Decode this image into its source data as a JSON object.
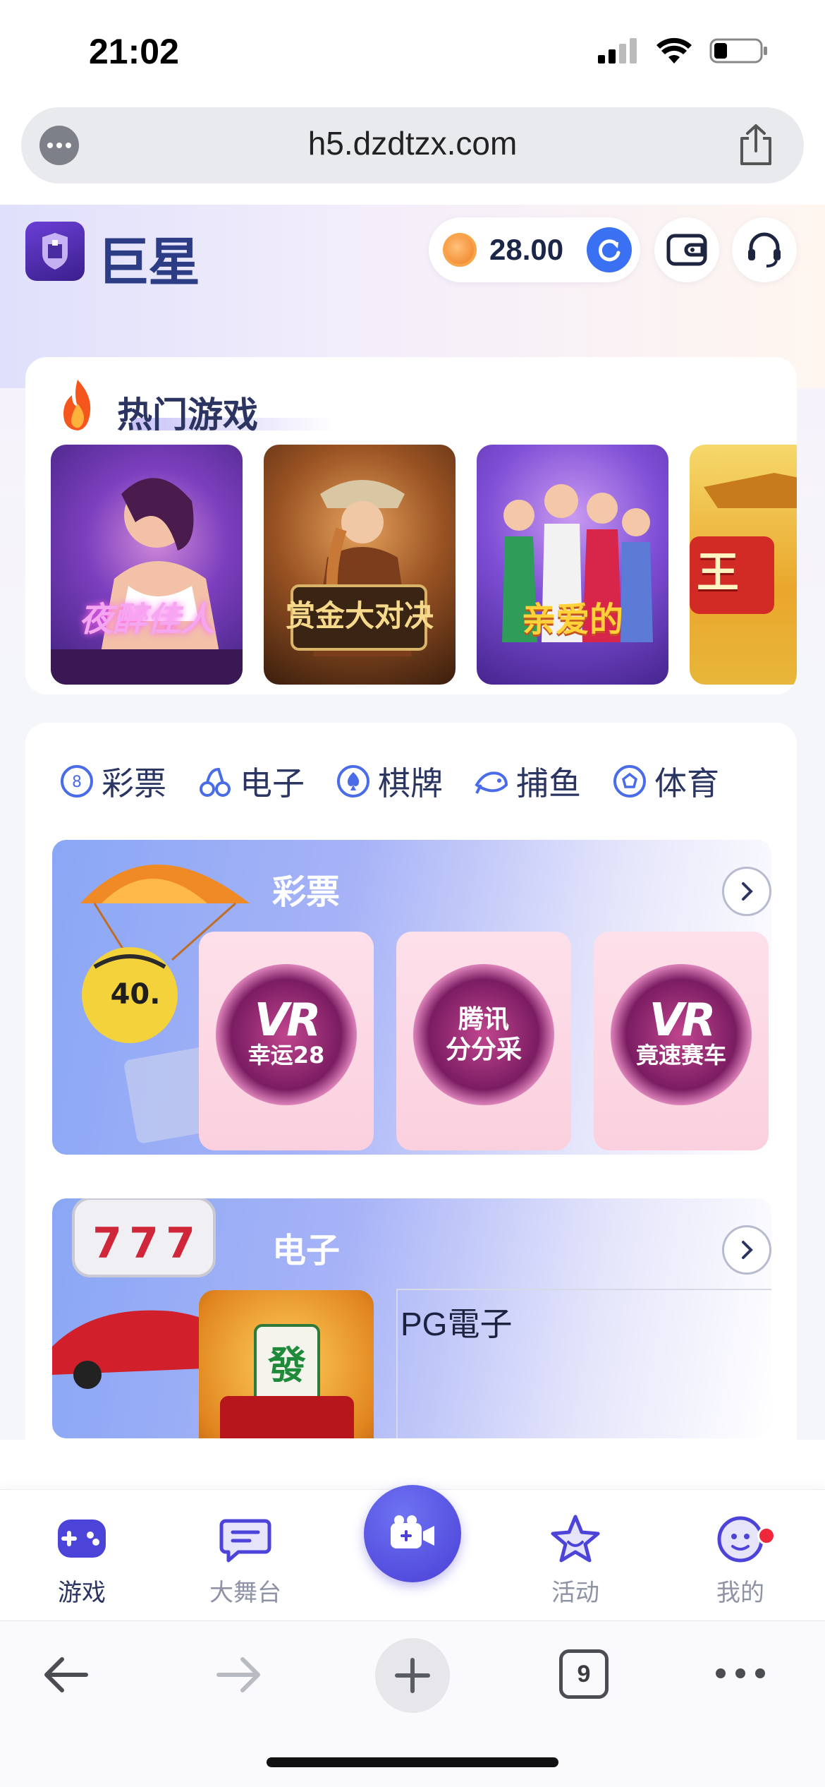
{
  "status": {
    "time": "21:02"
  },
  "browser": {
    "url": "h5.dzdtzx.com",
    "tab_count": "9"
  },
  "header": {
    "brand": "巨星",
    "balance": "28.00"
  },
  "hot_games": {
    "title": "热门游戏",
    "items": [
      {
        "label": "夜醉佳人"
      },
      {
        "label": "赏金大对决"
      },
      {
        "label": "亲爱的"
      },
      {
        "label": "王"
      }
    ]
  },
  "categories": {
    "tabs": [
      {
        "label": "彩票",
        "icon": "lottery-ball-icon"
      },
      {
        "label": "电子",
        "icon": "electronic-icon"
      },
      {
        "label": "棋牌",
        "icon": "spade-icon"
      },
      {
        "label": "捕鱼",
        "icon": "fish-icon"
      },
      {
        "label": "体育",
        "icon": "soccer-ball-icon"
      }
    ]
  },
  "lottery_section": {
    "title": "彩票",
    "items": [
      {
        "line1": "VR",
        "line2": "幸运28"
      },
      {
        "line1": "腾讯",
        "line2": "分分采"
      },
      {
        "line1": "VR",
        "line2": "竟速赛车"
      }
    ]
  },
  "electronic_section": {
    "title": "电子",
    "provider": "PG電子"
  },
  "app_nav": {
    "items": [
      {
        "label": "游戏",
        "icon": "gamepad-icon"
      },
      {
        "label": "大舞台",
        "icon": "chat-bubble-icon"
      },
      {
        "label": "",
        "icon": "video-camera-icon"
      },
      {
        "label": "活动",
        "icon": "star-icon"
      },
      {
        "label": "我的",
        "icon": "smiley-icon"
      }
    ]
  },
  "colors": {
    "accent": "#4a3fd6",
    "brand": "#2c3d86",
    "refresh": "#3a70f2",
    "badge": "#f0273b"
  }
}
